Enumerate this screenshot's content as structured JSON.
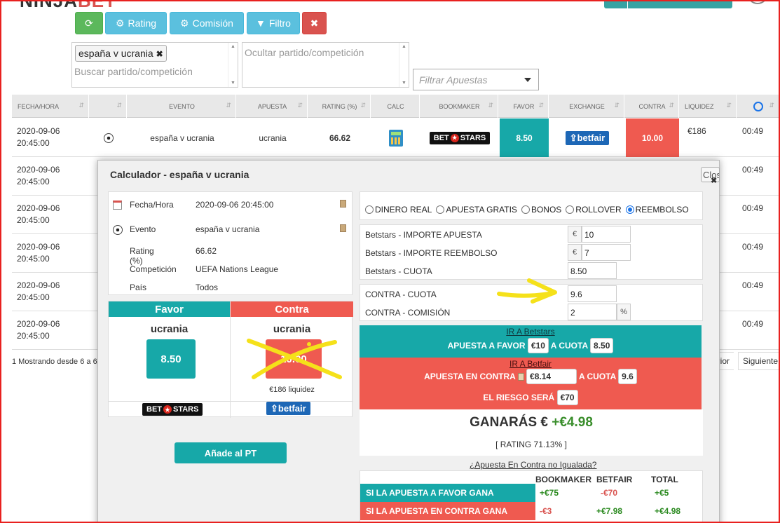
{
  "header": {
    "logo_dark": "NINJA",
    "logo_red": "BET"
  },
  "toolbar": {
    "rating_label": "Rating",
    "commission_label": "Comisión",
    "filter_label": "Filtro"
  },
  "filters": {
    "tag": "españa v ucrania",
    "search_placeholder": "Buscar partido/competición",
    "hide_placeholder": "Ocultar partido/competición",
    "bets_placeholder": "Filtrar Apuestas"
  },
  "table": {
    "headers": [
      "FECHA/HORA",
      "",
      "EVENTO",
      "APUESTA",
      "RATING (%)",
      "CALC",
      "BOOKMAKER",
      "FAVOR",
      "EXCHANGE",
      "CONTRA",
      "LIQUIDEZ",
      ""
    ],
    "first_row": {
      "date": "2020-09-06",
      "time": "20:45:00",
      "event": "españa v ucrania",
      "bet": "ucrania",
      "rating": "66.62",
      "favor": "8.50",
      "contra": "10.00",
      "liquidity": "€186",
      "clock": "00:49"
    },
    "other_rows": [
      {
        "date": "2020-09-06",
        "time": "20:45:00",
        "clock": "00:49"
      },
      {
        "date": "2020-09-06",
        "time": "20:45:00",
        "clock": "00:49"
      },
      {
        "date": "2020-09-06",
        "time": "20:45:00",
        "clock": "00:49"
      },
      {
        "date": "2020-09-06",
        "time": "20:45:00",
        "clock": "00:49"
      },
      {
        "date": "2020-09-06",
        "time": "20:45:00",
        "clock": "00:49"
      }
    ],
    "footer_text": "1 Mostrando desde 6 a 6",
    "pager_prev": "erior",
    "pager_next": "Siguiente"
  },
  "modal": {
    "title": "Calculador - españa v ucrania",
    "close_label": "Close",
    "info": {
      "date_label": "Fecha/Hora",
      "date_value": "2020-09-06 20:45:00",
      "event_label": "Evento",
      "event_value": "españa v ucrania",
      "rating_label": "Rating (%)",
      "rating_value": "66.62",
      "competition_label": "Competición",
      "competition_value": "UEFA Nations League",
      "country_label": "País",
      "country_value": "Todos"
    },
    "favor": {
      "title": "Favor",
      "pick": "ucrania",
      "odds": "8.50"
    },
    "contra": {
      "title": "Contra",
      "pick": "ucrania",
      "odds": "10.00",
      "liquidity": "€186 liquidez"
    },
    "bookmaker_logo": "BET STARS",
    "exchange_logo": "betfair",
    "add_button": "Añade al PT",
    "modes": [
      "DINERO REAL",
      "APUESTA GRATIS",
      "BONOS",
      "ROLLOVER",
      "REEMBOLSO"
    ],
    "selected_mode": "REEMBOLSO",
    "form": {
      "stake_label": "Betstars - IMPORTE APUESTA",
      "stake_value": "10",
      "refund_label": "Betstars - IMPORTE REEMBOLSO",
      "refund_value": "7",
      "odds_label": "Betstars - CUOTA",
      "odds_value": "8.50",
      "lay_odds_label": "CONTRA - CUOTA",
      "lay_odds_value": "9.6",
      "commission_label": "CONTRA - COMISIÓN",
      "commission_value": "2",
      "currency": "€",
      "percent": "%"
    },
    "back_band": {
      "link": "IR A Betstars",
      "text1": "APUESTA A FAVOR",
      "stake": "€10",
      "text2": "A CUOTA",
      "odds": "8.50"
    },
    "lay_band": {
      "link": "IR A Betfair",
      "text1": "APUESTA EN CONTRA",
      "stake": "€8.14",
      "text2": "A CUOTA",
      "odds": "9.6",
      "risk_text": "EL RIESGO SERÁ",
      "risk": "€70"
    },
    "result": {
      "label": "GANARÁS €",
      "value": "+€4.98",
      "rating": "[ RATING 71.13% ]"
    },
    "unmatched_link": "¿Apuesta En Contra no Igualada?",
    "summary": {
      "headers": [
        "BOOKMAKER",
        "BETFAIR",
        "TOTAL"
      ],
      "rows": [
        {
          "label": "SI LA APUESTA A FAVOR GANA",
          "bookmaker": "+€75",
          "betfair": "-€70",
          "total": "+€5"
        },
        {
          "label": "SI LA APUESTA EN CONTRA GANA",
          "bookmaker": "-€3",
          "betfair": "+€7.98",
          "total": "+€4.98"
        }
      ]
    }
  },
  "colors": {
    "teal": "#17a8a8",
    "red": "#ef5a50",
    "green": "#2b8a20",
    "yellow_annotation": "#f5e11a"
  }
}
